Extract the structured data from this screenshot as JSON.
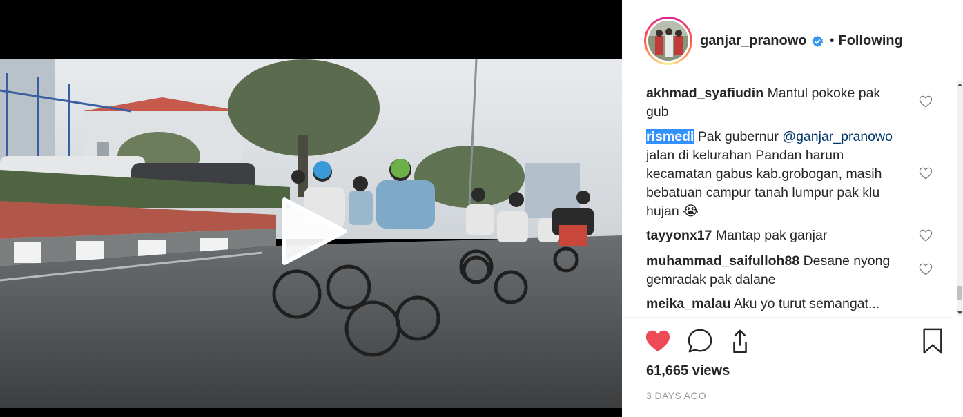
{
  "post": {
    "author": "ganjar_pranowo",
    "separator": "•",
    "follow_status": "Following",
    "views_count": "61,665",
    "views_label": "views",
    "timestamp": "3 DAYS AGO"
  },
  "comments": [
    {
      "user": "akhmad_syafiudin",
      "text": "Mantul pokoke pak gub",
      "highlighted": false
    },
    {
      "user": "rismedi",
      "text_before": "Pak gubernur",
      "mention": "@ganjar_pranowo",
      "text_after": "jalan di kelurahan Pandan harum kecamatan gabus kab.grobogan, masih bebatuan campur tanah lumpur pak klu hujan",
      "emoji": "😭",
      "highlighted": true
    },
    {
      "user": "tayyonx17",
      "text": "Mantap pak ganjar",
      "highlighted": false
    },
    {
      "user": "muhammad_saifulloh88",
      "text": "Desane nyong gemradak pak dalane",
      "highlighted": false
    },
    {
      "user": "meika_malau",
      "text": "Aku yo turut semangat...",
      "highlighted": false
    }
  ],
  "colors": {
    "like_red": "#ed4956",
    "verified_blue": "#3897f0",
    "mention_blue": "#003569",
    "selection_blue": "#3390ff",
    "muted_gray": "#999999"
  },
  "icons": [
    "play-icon",
    "verified-badge-icon",
    "heart-outline-icon",
    "heart-filled-icon",
    "comment-icon",
    "share-icon",
    "bookmark-icon"
  ],
  "video": {
    "state": "paused"
  }
}
